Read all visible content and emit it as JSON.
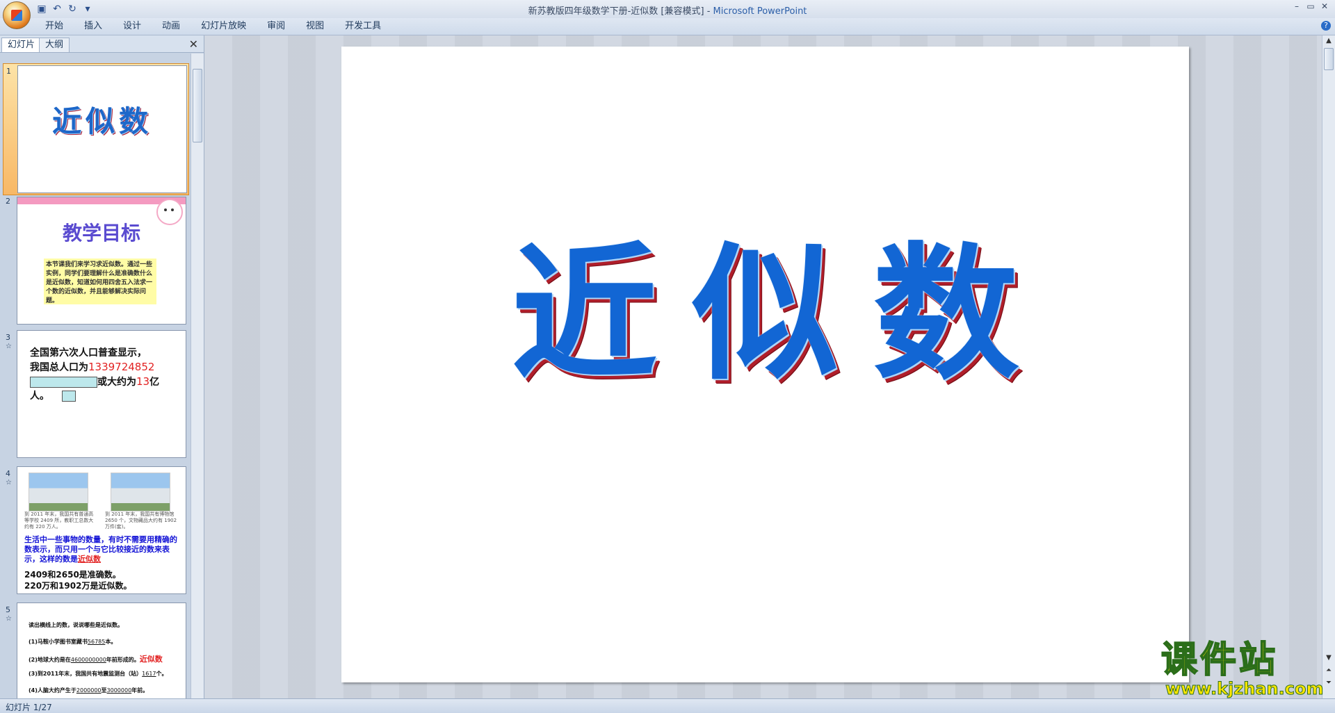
{
  "title_bar": {
    "doc_title": "新苏教版四年级数学下册-近似数 [兼容模式]",
    "separator": " - ",
    "app_name": "Microsoft PowerPoint"
  },
  "ribbon": {
    "tabs": [
      "开始",
      "插入",
      "设计",
      "动画",
      "幻灯片放映",
      "审阅",
      "视图",
      "开发工具"
    ]
  },
  "left_pane": {
    "tabs": [
      "幻灯片",
      "大纲"
    ],
    "slides": [
      {
        "num": "1",
        "title": "近似数"
      },
      {
        "num": "2",
        "title": "教学目标",
        "body": "本节课我们来学习求近似数。通过一些实例，同学们要理解什么是准确数什么是近似数，知道如何用四舍五入法求一个数的近似数，并且能够解决实际问题。"
      },
      {
        "num": "3",
        "line1": "全国第六次人口普查显示，",
        "line2a": "我国总人口为",
        "number": "1339724852",
        "line3b": "或大约为",
        "approx": "13",
        "line3c": "亿",
        "line4": "人。"
      },
      {
        "num": "4",
        "cap1": "到 2011 年末，我国共有普通高等学校 2409 所，教职工总数大约有 220 万人。",
        "cap2": "到 2011 年末，我国共有博物馆 2650 个，文物藏品大约有 1902 万件(套)。",
        "blue_text": "生活中一些事物的数量，有时不需要用精确的数表示，而只用一个与它比较接近的数来表示，这样的数是",
        "blue_red": "近似数",
        "line_a": "2409和2650是准确数。",
        "line_b": "220万和1902万是近似数。"
      },
      {
        "num": "5",
        "l1": "读出横线上的数，说说哪些是近似数。",
        "l2a": "(1)马鞍小学图书室藏书",
        "l2n": "56785",
        "l2b": "本。",
        "l3a": "(2)地球大约是在",
        "l3n": "4600000000",
        "l3b": "年前形成的。",
        "l3r": "近似数",
        "l4a": "(3)到2011年末，我国共有地震监测台（站）",
        "l4n": "1617",
        "l4b": "个。",
        "l5a": "(4)人脑大约产生于",
        "l5n": "2000000",
        "l5m": "至",
        "l5n2": "3000000",
        "l5b": "年前。"
      }
    ]
  },
  "main_slide": {
    "title": "近似数"
  },
  "status_bar": {
    "slide_info": "幻灯片 1/27"
  },
  "watermark": {
    "cn": "课件站",
    "url": "www.kjzhan.com"
  }
}
